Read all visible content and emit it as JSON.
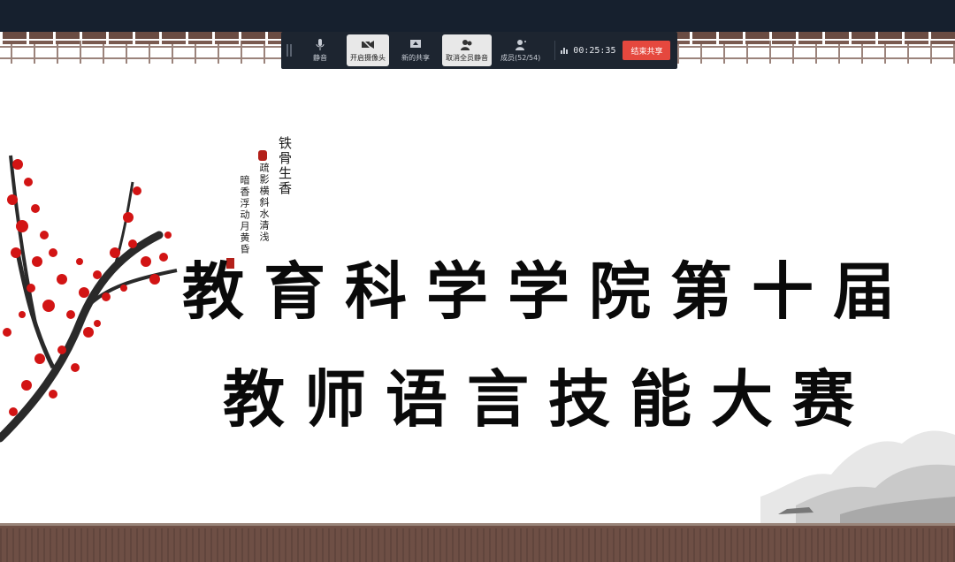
{
  "toolbar": {
    "mute_label": "静音",
    "camera_label": "开启摄像头",
    "share_label": "新的共享",
    "mute_all_label": "取消全员静音",
    "members_label": "成员(52/54)",
    "timer": "00:25:35",
    "end_share_label": "结束共享",
    "accent_color": "#e5483e"
  },
  "slide": {
    "poem_col_1": "铁骨生香",
    "poem_col_2": "疏影横斜水清浅",
    "poem_col_3": "暗香浮动月黄昏",
    "title_line_1": "教育科学学院第十届",
    "title_line_2": "教师语言技能大赛",
    "blossom_color": "#d21414"
  }
}
